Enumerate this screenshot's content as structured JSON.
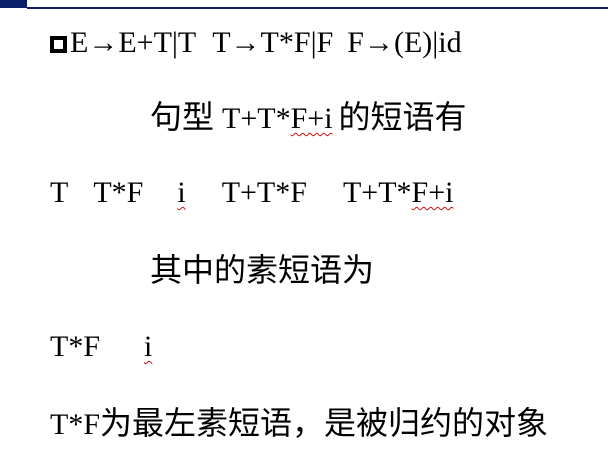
{
  "grammar": {
    "prod1": "E→E+T|T",
    "prod2": "T→T*F|F",
    "prod3": "F→(E)|id"
  },
  "phrases_heading": {
    "prefix": "句型",
    "form_plain": "T+T*",
    "form_marked": "F+i",
    "suffix": "的短语有"
  },
  "phrases_list": {
    "p1": "T",
    "p2": "T*F",
    "p3": "i",
    "p4": "T+T*F",
    "p5_plain": "T+T*",
    "p5_marked": "F+i"
  },
  "simple_heading": "其中的素短语为",
  "simple_list": {
    "s1": "T*F",
    "s2": "i"
  },
  "conclusion": {
    "term": "T*F",
    "text": "为最左素短语，是被归约的对象"
  },
  "colors": {
    "accent": "#0b1f6b",
    "spellcheck": "#d01010"
  }
}
